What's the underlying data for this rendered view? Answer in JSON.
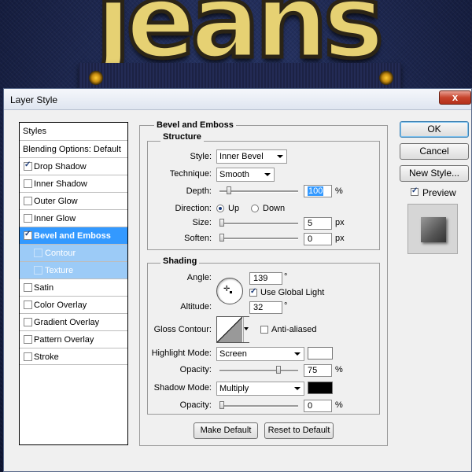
{
  "background": {
    "title_art": "jeans"
  },
  "dialog": {
    "title": "Layer Style",
    "close_glyph": "x",
    "styles_list": [
      {
        "label": "Styles",
        "kind": "header"
      },
      {
        "label": "Blending Options: Default",
        "kind": "header"
      },
      {
        "label": "Drop Shadow",
        "checked": true
      },
      {
        "label": "Inner Shadow",
        "checked": false
      },
      {
        "label": "Outer Glow",
        "checked": false
      },
      {
        "label": "Inner Glow",
        "checked": false
      },
      {
        "label": "Bevel and Emboss",
        "checked": true,
        "selected": true
      },
      {
        "label": "Contour",
        "checked": false,
        "sub": true
      },
      {
        "label": "Texture",
        "checked": false,
        "sub": true
      },
      {
        "label": "Satin",
        "checked": false
      },
      {
        "label": "Color Overlay",
        "checked": false
      },
      {
        "label": "Gradient Overlay",
        "checked": false
      },
      {
        "label": "Pattern Overlay",
        "checked": false
      },
      {
        "label": "Stroke",
        "checked": false
      }
    ],
    "bevel": {
      "section_title": "Bevel and Emboss",
      "structure_title": "Structure",
      "style_label": "Style:",
      "style_value": "Inner Bevel",
      "technique_label": "Technique:",
      "technique_value": "Smooth",
      "depth_label": "Depth:",
      "depth_value": "100",
      "depth_unit": "%",
      "direction_label": "Direction:",
      "direction_up": "Up",
      "direction_down": "Down",
      "size_label": "Size:",
      "size_value": "5",
      "size_unit": "px",
      "soften_label": "Soften:",
      "soften_value": "0",
      "soften_unit": "px"
    },
    "shading": {
      "title": "Shading",
      "angle_label": "Angle:",
      "angle_value": "139",
      "angle_unit": "°",
      "global_light_label": "Use Global Light",
      "global_light_checked": true,
      "altitude_label": "Altitude:",
      "altitude_value": "32",
      "altitude_unit": "°",
      "gloss_label": "Gloss Contour:",
      "anti_aliased_label": "Anti-aliased",
      "anti_aliased_checked": false,
      "highlight_mode_label": "Highlight Mode:",
      "highlight_mode_value": "Screen",
      "highlight_color": "#ffffff",
      "highlight_opacity_label": "Opacity:",
      "highlight_opacity_value": "75",
      "highlight_opacity_unit": "%",
      "shadow_mode_label": "Shadow Mode:",
      "shadow_mode_value": "Multiply",
      "shadow_color": "#000000",
      "shadow_opacity_label": "Opacity:",
      "shadow_opacity_value": "0",
      "shadow_opacity_unit": "%"
    },
    "buttons": {
      "ok": "OK",
      "cancel": "Cancel",
      "new_style": "New Style...",
      "preview_label": "Preview",
      "preview_checked": true,
      "make_default": "Make Default",
      "reset_default": "Reset to Default"
    }
  }
}
